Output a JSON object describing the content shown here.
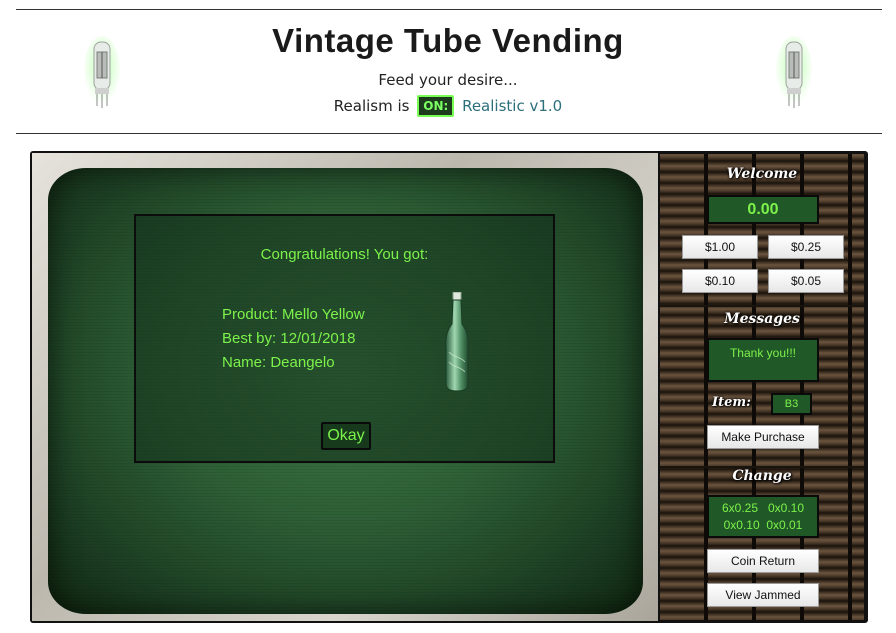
{
  "header": {
    "title": "Vintage Tube Vending",
    "tagline": "Feed your desire...",
    "realism_prefix": "Realism is",
    "realism_toggle": "ON:",
    "realism_version": "Realistic v1.0"
  },
  "dialog": {
    "heading": "Congratulations! You got:",
    "product": "Product: Mello Yellow",
    "best_by": "Best by: 12/01/2018",
    "name": "Name: Deangelo",
    "okay_label": "Okay"
  },
  "panel": {
    "welcome_title": "Welcome",
    "balance": "0.00",
    "coin_buttons": [
      "$1.00",
      "$0.25",
      "$0.10",
      "$0.05"
    ],
    "messages_title": "Messages",
    "message": "Thank you!!!",
    "item_label": "Item:",
    "item_value": "B3",
    "purchase_label": "Make Purchase",
    "change_title": "Change",
    "change_lines": [
      "6x0.25   0x0.10",
      "0x0.10  0x0.01"
    ],
    "coin_return_label": "Coin Return",
    "view_jammed_label": "View Jammed"
  },
  "colors": {
    "lcd_text": "#7cf24a",
    "lcd_bg": "#215827",
    "screen_green": "#2d5e35"
  }
}
